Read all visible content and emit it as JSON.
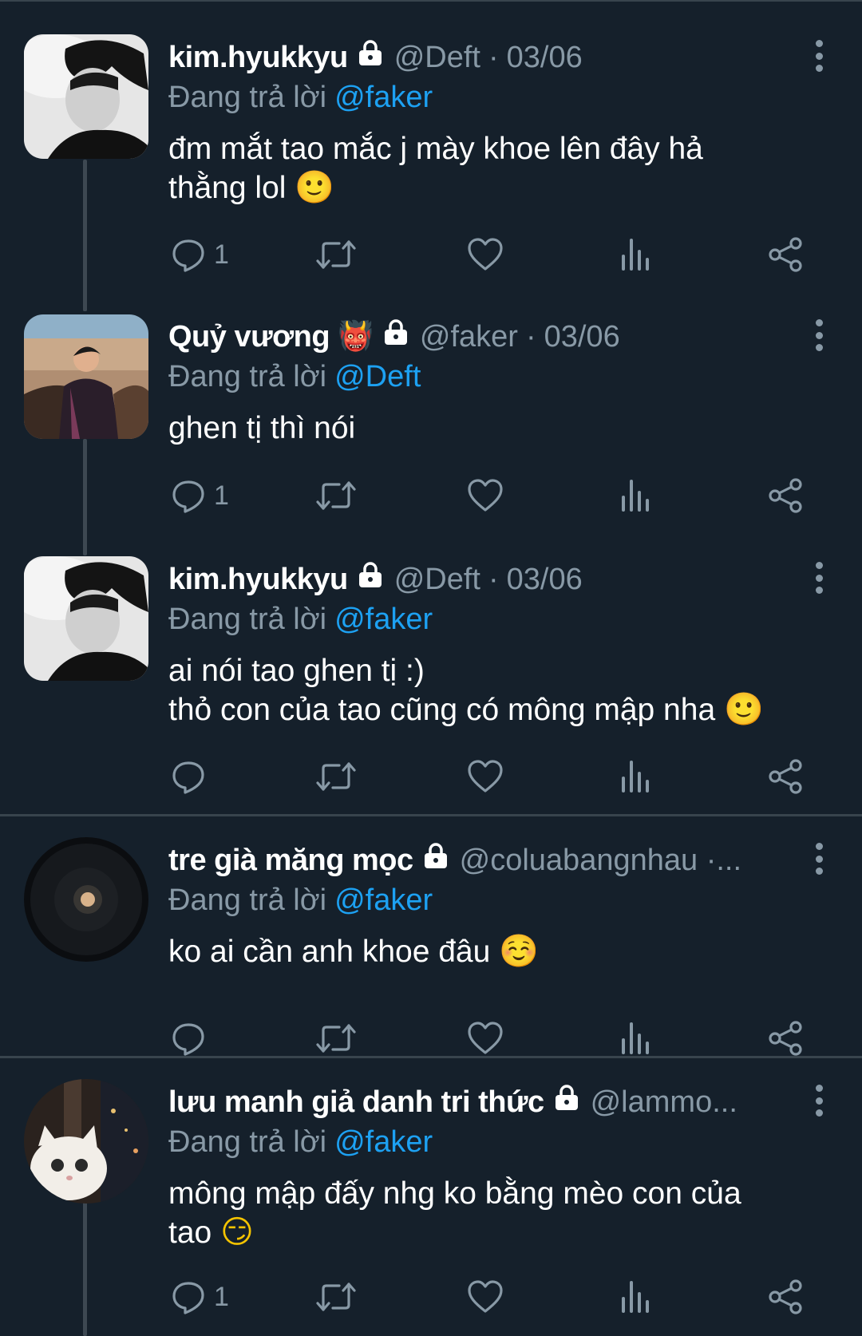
{
  "reply_prefix": "Đang trả lời",
  "tweets": [
    {
      "name": "kim.hyukkyu",
      "name_emoji": "",
      "handle": "@Deft",
      "separator": "·",
      "date": "03/06",
      "reply_to": "@faker",
      "lines": [
        "đm mắt tao mắc j mày khoe lên đây hả",
        "thằng lol"
      ],
      "end_emoji": "🙂",
      "reply_count": "1",
      "avatar": "photo-man-grayscale"
    },
    {
      "name": "Quỷ vương",
      "name_emoji": "👹",
      "handle": "@faker",
      "separator": "·",
      "date": "03/06",
      "reply_to": "@Deft",
      "lines": [
        "ghen tị thì nói"
      ],
      "end_emoji": "",
      "reply_count": "1",
      "avatar": "photo-man-suit-beach"
    },
    {
      "name": "kim.hyukkyu",
      "name_emoji": "",
      "handle": "@Deft",
      "separator": "·",
      "date": "03/06",
      "reply_to": "@faker",
      "lines": [
        "ai nói tao ghen tị :)",
        "thỏ con của tao cũng có mông mập nha"
      ],
      "end_emoji": "🙂",
      "reply_count": "",
      "avatar": "photo-man-grayscale"
    },
    {
      "name": "tre già măng mọc",
      "name_emoji": "",
      "handle": "@coluabangnhau ·...",
      "separator": "",
      "date": "",
      "reply_to": "@faker",
      "lines": [
        "ko ai cần anh khoe đâu"
      ],
      "end_emoji": "☺️",
      "reply_count": "",
      "avatar": "photo-moon-night"
    },
    {
      "name": "lưu manh giả danh tri thức",
      "name_emoji": "",
      "handle": "@lammo...",
      "separator": "",
      "date": "",
      "reply_to": "@faker",
      "lines": [
        "mông mập đấy nhg ko bằng mèo con của",
        "tao"
      ],
      "end_emoji": "😏",
      "reply_count": "1",
      "avatar": "photo-white-cat"
    }
  ],
  "icons": {
    "reply": "reply-icon",
    "retweet": "retweet-icon",
    "like": "heart-icon",
    "analytics": "analytics-icon",
    "share": "share-icon",
    "lock": "lock-icon",
    "more": "more-vertical-icon"
  },
  "colors": {
    "background": "#15202b",
    "muted": "#8899a6",
    "mention": "#1da1f2",
    "divider": "#38444d"
  }
}
